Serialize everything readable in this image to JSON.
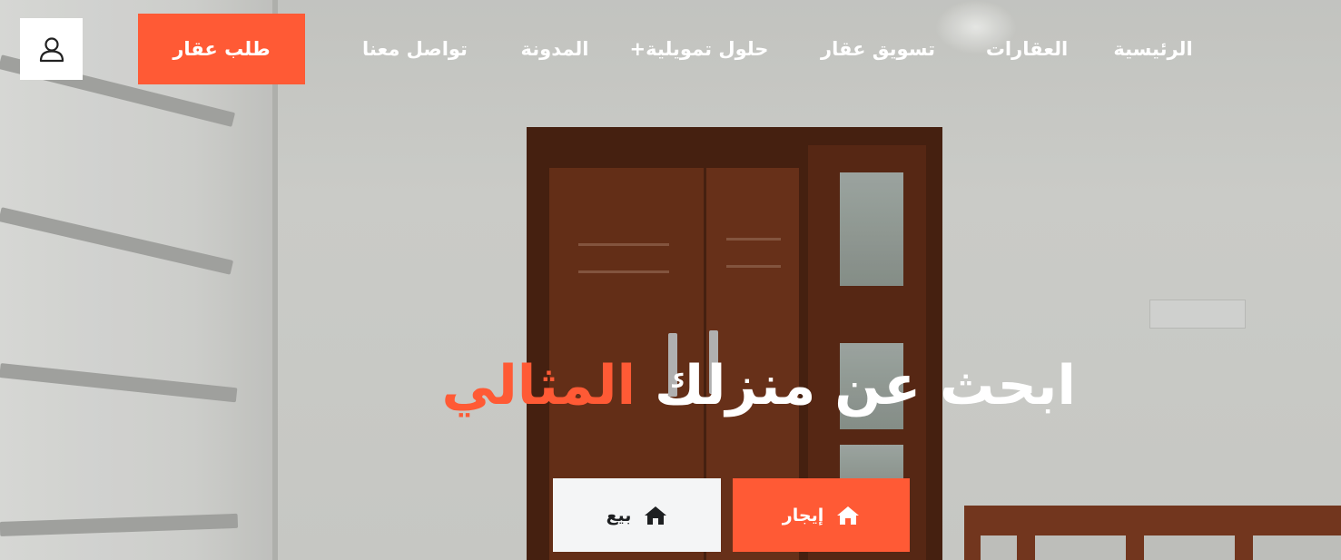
{
  "nav": {
    "items": [
      {
        "label": "الرئيسية"
      },
      {
        "label": "العقارات"
      },
      {
        "label": "تسويق عقار"
      },
      {
        "label": "حلول تمويلية+"
      },
      {
        "label": "المدونة"
      },
      {
        "label": "تواصل معنا"
      }
    ],
    "cta_label": "طلب عقار",
    "user_icon": "user-icon"
  },
  "hero": {
    "headline_main": "ابحث عن منزلك",
    "headline_accent": "المثالي"
  },
  "tabs": [
    {
      "label": "إيجار",
      "icon": "home-icon",
      "active": true
    },
    {
      "label": "بيع",
      "icon": "home-icon",
      "active": false
    }
  ],
  "colors": {
    "accent": "#ff5a35",
    "text_light": "#ffffff",
    "tab_inactive_bg": "#f4f5f6",
    "tab_inactive_text": "#1d1f21"
  }
}
